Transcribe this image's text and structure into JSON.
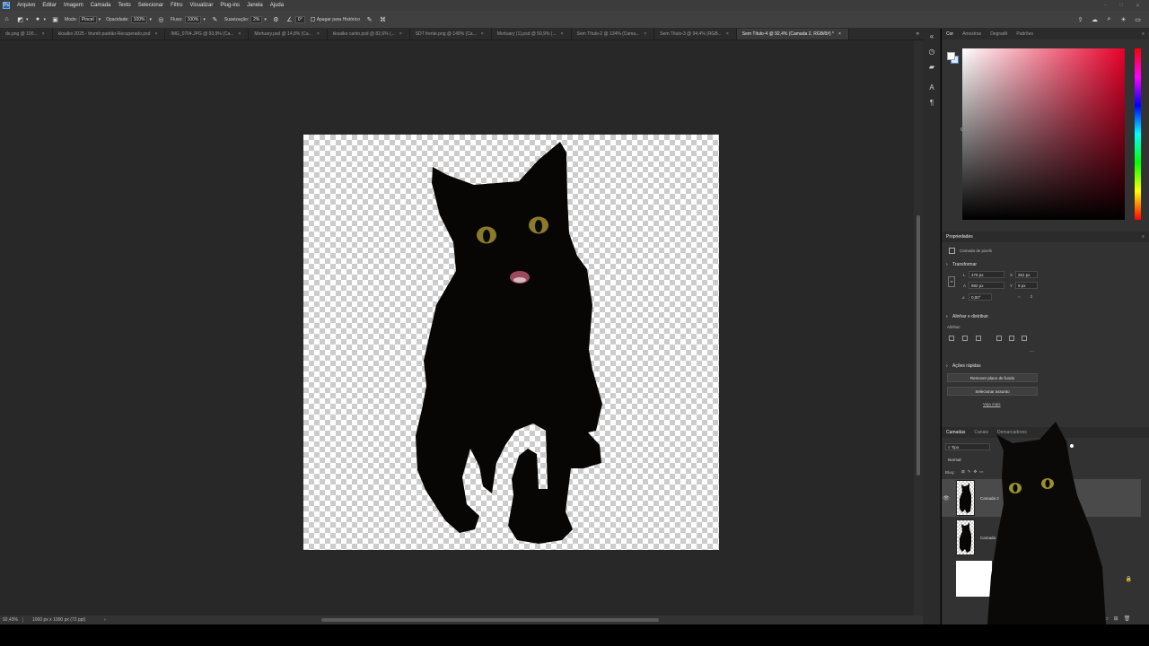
{
  "menu": [
    "Arquivo",
    "Editar",
    "Imagem",
    "Camada",
    "Texto",
    "Selecionar",
    "Filtro",
    "Visualizar",
    "Plug-ins",
    "Janela",
    "Ajuda"
  ],
  "options": {
    "mode_label": "Modo:",
    "mode_value": "Pincel",
    "opacity_label": "Opacidade:",
    "opacity_value": "100%",
    "flow_label": "Fluxo:",
    "flow_value": "100%",
    "smoothing_label": "Suavização:",
    "smoothing_value": "2%",
    "angle_value": "0°",
    "erase_history_label": "Apagar para Histórico"
  },
  "tabs": [
    {
      "label": "do.png @ 100...",
      "active": false
    },
    {
      "label": "kksalko 2025 - thumb padrão-Recuperado.psd",
      "active": false
    },
    {
      "label": "IMG_0704.JPG @ 93,9% (Ca...",
      "active": false
    },
    {
      "label": "Mortuary.psd @ 14,8% (Ca...",
      "active": false
    },
    {
      "label": "kksalko canto.psd @ 82,6% (...",
      "active": false
    },
    {
      "label": "SDT frente.png @ 149% (Ca...",
      "active": false
    },
    {
      "label": "Mortuary (1).psd @ 50,9% (...",
      "active": false
    },
    {
      "label": "Sem Título-2 @ 134% (Cama...",
      "active": false
    },
    {
      "label": "Sem Título-3 @ 94,4% (RGB...",
      "active": false
    },
    {
      "label": "Sem Título-4 @ 92,4% (Camada 2, RGB/8#) *",
      "active": true
    }
  ],
  "status": {
    "zoom": "92,43%",
    "doc_info": "1000 px x 1000 px (72 ppi)"
  },
  "color_panel": {
    "tabs": [
      "Cor",
      "Amostras",
      "Degradê",
      "Padrões"
    ],
    "fg": "#ffffff",
    "hue": "#e8002a"
  },
  "properties": {
    "title": "Propriedades",
    "layer_type": "Camada de pixels",
    "transform_title": "Transformar",
    "w_label": "L",
    "w_value": "476 px",
    "h_label": "A",
    "h_value": "982 px",
    "x_label": "X",
    "x_value": "261 px",
    "y_label": "Y",
    "y_value": "9 px",
    "angle_value": "0,00°",
    "align_title": "Alinhar e distribuir",
    "align_label": "Alinhar:",
    "more": "...",
    "quick_title": "Ações rápidas",
    "remove_bg": "Remover plano de fundo",
    "select_subject": "Selecionar assunto",
    "see_more": "Veja mais"
  },
  "layers_panel": {
    "tabs": [
      "Camadas",
      "Canais",
      "Demarcadores"
    ],
    "filter": "Tipo",
    "blend": "Normal",
    "lock_label": "Bloq.:",
    "items": [
      {
        "name": "Camada 2",
        "selected": true
      },
      {
        "name": "Camada 1",
        "selected": false
      },
      {
        "name": "",
        "selected": false
      }
    ]
  },
  "accent": "#3b8ae6"
}
